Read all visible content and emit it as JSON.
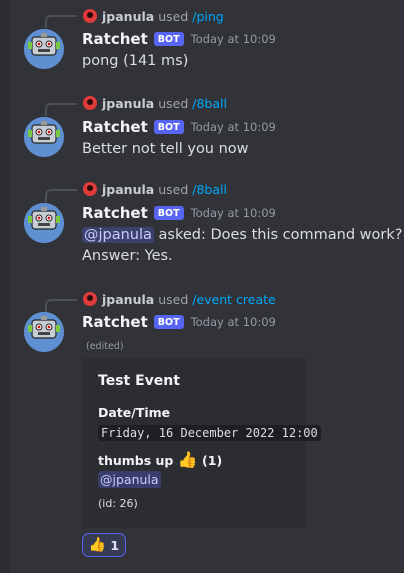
{
  "colors": {
    "background": "#313338",
    "bot_tag": "#5865f2",
    "command_link": "#00a8fc",
    "mention_bg": "#3c4270",
    "embed_bg": "#2b2d31",
    "reaction_border": "#5865f2"
  },
  "messages": [
    {
      "reference": {
        "user": "jpanula",
        "used": "used",
        "command": "/ping"
      },
      "author": "Ratchet",
      "bot_tag": "BOT",
      "timestamp": "Today at 10:09",
      "content": "pong (141 ms)"
    },
    {
      "reference": {
        "user": "jpanula",
        "used": "used",
        "command": "/8ball"
      },
      "author": "Ratchet",
      "bot_tag": "BOT",
      "timestamp": "Today at 10:09",
      "content": "Better not tell you now"
    },
    {
      "reference": {
        "user": "jpanula",
        "used": "used",
        "command": "/8ball"
      },
      "author": "Ratchet",
      "bot_tag": "BOT",
      "timestamp": "Today at 10:09",
      "mention": "@jpanula",
      "content_rest": " asked: Does this command work?",
      "answer": "Answer: Yes."
    },
    {
      "reference": {
        "user": "jpanula",
        "used": "used",
        "command": "/event create"
      },
      "author": "Ratchet",
      "bot_tag": "BOT",
      "timestamp": "Today at 10:09",
      "edited": "(edited)",
      "embed": {
        "title": "Test Event",
        "datetime_label": "Date/Time",
        "datetime_value": "Friday, 16 December 2022 12:00",
        "thumbs_label": "thumbs up",
        "thumbs_emoji": "👍",
        "thumbs_count": "(1)",
        "attendee": "@jpanula",
        "id_text": "(id: 26)"
      },
      "reaction": {
        "emoji": "👍",
        "count": "1"
      }
    }
  ]
}
